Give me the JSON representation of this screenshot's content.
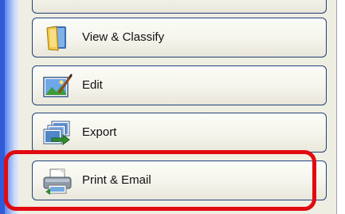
{
  "sidebar": {
    "items": [
      {
        "label": "",
        "icon": "blank"
      },
      {
        "label": "View & Classify",
        "icon": "folder-icon"
      },
      {
        "label": "Edit",
        "icon": "picture-edit-icon"
      },
      {
        "label": "Export",
        "icon": "export-icon"
      },
      {
        "label": "Print & Email",
        "icon": "printer-icon"
      }
    ],
    "highlighted_item": "Print & Email"
  },
  "colors": {
    "highlight_ring": "#e10a10",
    "button_border": "#1f3f79",
    "panel_background": "#efeee2",
    "left_strip": "#2f5ad8"
  }
}
